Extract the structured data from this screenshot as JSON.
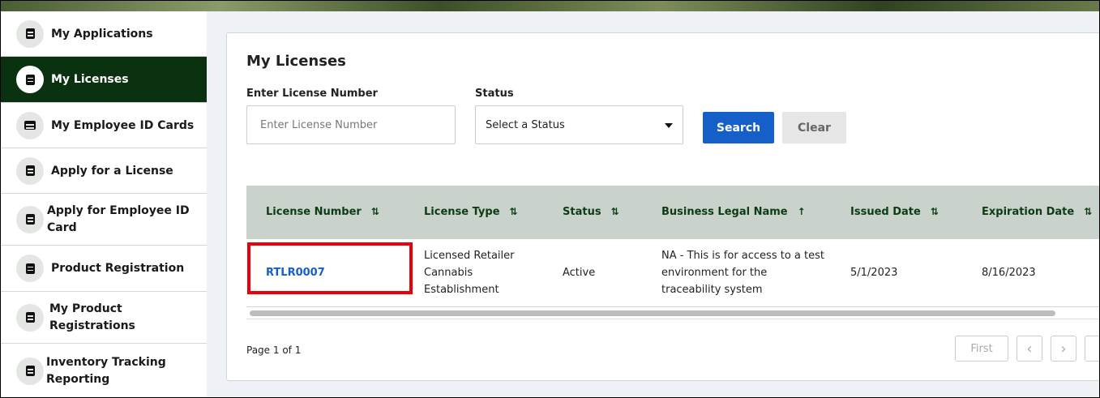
{
  "sidebar": {
    "items": [
      {
        "label": "My Applications"
      },
      {
        "label": "My Licenses",
        "active": true
      },
      {
        "label": "My Employee ID Cards"
      },
      {
        "label": "Apply for a License"
      },
      {
        "label": "Apply for Employee ID Card"
      },
      {
        "label": "Product Registration"
      },
      {
        "label": "My Product Registrations"
      },
      {
        "label": "Inventory Tracking Reporting"
      }
    ]
  },
  "main": {
    "title": "My Licenses",
    "license_label": "Enter License Number",
    "license_placeholder": "Enter License Number",
    "status_label": "Status",
    "status_value": "Select a Status",
    "search_label": "Search",
    "clear_label": "Clear",
    "columns": [
      {
        "label": "License Number",
        "sort": "⇅"
      },
      {
        "label": "License Type",
        "sort": "⇅"
      },
      {
        "label": "Status",
        "sort": "⇅"
      },
      {
        "label": "Business Legal Name",
        "sort": "↑"
      },
      {
        "label": "Issued Date",
        "sort": "⇅"
      },
      {
        "label": "Expiration Date",
        "sort": "⇅"
      }
    ],
    "rows": [
      {
        "license_number": "RTLR0007",
        "license_type": "Licensed Retailer Cannabis Establishment",
        "status": "Active",
        "business_legal_name": "NA - This is for access to a test environment for the traceability system",
        "issued_date": "5/1/2023",
        "expiration_date": "8/16/2023"
      }
    ],
    "page_info": "Page 1 of 1",
    "pager": {
      "first": "First",
      "prev": "‹",
      "next": "›"
    }
  }
}
